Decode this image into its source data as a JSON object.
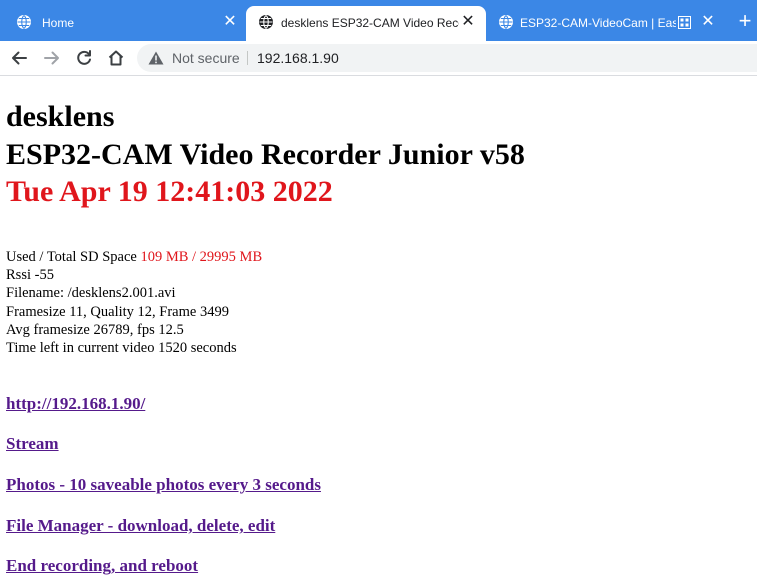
{
  "browser": {
    "tabs": [
      {
        "title": "Home",
        "active": false,
        "icon": "globe-icon"
      },
      {
        "title": "desklens ESP32-CAM Video Reco",
        "active": true,
        "icon": "globe-icon"
      },
      {
        "title": "ESP32-CAM-VideoCam | Easy",
        "active": false,
        "icon": "globe-icon"
      }
    ],
    "new_tab_label": "+",
    "close_label": "✕",
    "address_bar": {
      "security_label": "Not secure",
      "url": "192.168.1.90"
    },
    "colors": {
      "tabstrip": "#3b87e6",
      "omnibox": "#f1f3f4"
    }
  },
  "page": {
    "device_name": "desklens",
    "version_title": "ESP32-CAM Video Recorder Junior v58",
    "datetime": "Tue Apr 19 12:41:03 2022",
    "stats": {
      "sd_label": "Used / Total SD Space",
      "sd_used": "109 MB",
      "sd_sep": "/",
      "sd_total": "29995 MB",
      "rssi": "Rssi -55",
      "filename": "Filename: /desklens2.001.avi",
      "frame_info": "Framesize 11, Quality 12, Frame 3499",
      "avg_info": "Avg framesize 26789, fps 12.5",
      "time_left": "Time left in current video 1520 seconds"
    },
    "links": [
      "http://192.168.1.90/",
      "Stream",
      "Photos - 10 saveable photos every 3 seconds",
      "File Manager - download, delete, edit",
      "End recording, and reboot"
    ],
    "colors": {
      "highlight": "#e0161c",
      "link_visited": "#551a8b"
    }
  }
}
